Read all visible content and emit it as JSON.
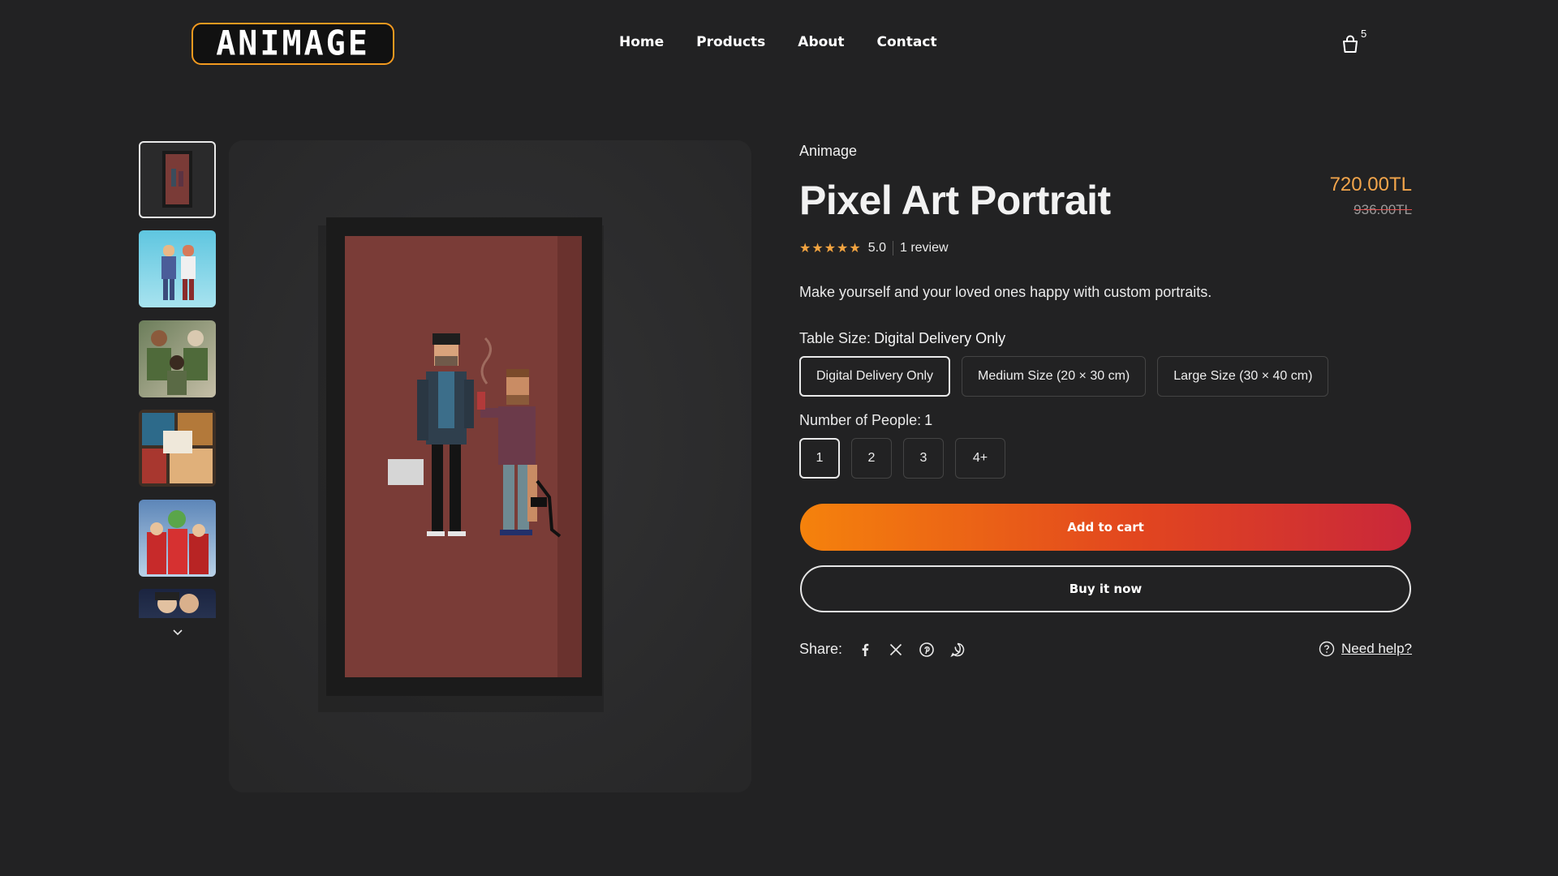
{
  "header": {
    "logo_text": "ANIMAGE",
    "nav": [
      "Home",
      "Products",
      "About",
      "Contact"
    ],
    "cart_count": "5"
  },
  "gallery": {
    "thumbnail_count": 6,
    "selected_index": 0
  },
  "product": {
    "vendor": "Animage",
    "title": "Pixel Art Portrait",
    "price": "720.00TL",
    "compare_price": "936.00TL",
    "rating_stars": "★★★★★",
    "rating_value": "5.0",
    "review_count": "1 review",
    "description": "Make yourself and your loved ones happy with custom portraits.",
    "size_option": {
      "label": "Table Size:",
      "selected": "Digital Delivery Only",
      "values": [
        "Digital Delivery Only",
        "Medium Size (20 × 30 cm)",
        "Large Size (30 × 40 cm)"
      ]
    },
    "people_option": {
      "label": "Number of People:",
      "selected": "1",
      "values": [
        "1",
        "2",
        "3",
        "4+"
      ]
    },
    "add_to_cart_label": "Add to cart",
    "buy_now_label": "Buy it now",
    "share_label": "Share:",
    "help_label": "Need help?"
  },
  "colors": {
    "background": "#222223",
    "accent_orange": "#f5820c",
    "accent_red": "#c9273a",
    "price": "#f3a54b"
  }
}
